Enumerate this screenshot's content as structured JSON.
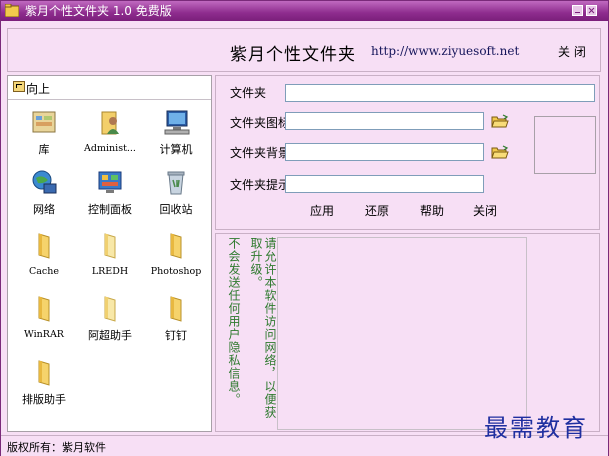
{
  "window": {
    "title": "紫月个性文件夹 1.0 免费版",
    "accent": "#8e2c8e",
    "background": "#f7dff5"
  },
  "header": {
    "app_title": "紫月个性文件夹",
    "url": "http://www.ziyuesoft.net",
    "close_label": "关 闭"
  },
  "left": {
    "up_label": "向上",
    "items": [
      {
        "label": "库",
        "icon": "library-icon"
      },
      {
        "label": "Administ...",
        "icon": "user-folder-icon"
      },
      {
        "label": "计算机",
        "icon": "computer-icon"
      },
      {
        "label": "网络",
        "icon": "network-icon"
      },
      {
        "label": "控制面板",
        "icon": "control-panel-icon"
      },
      {
        "label": "回收站",
        "icon": "recycle-bin-icon"
      },
      {
        "label": "Cache",
        "icon": "folder-icon"
      },
      {
        "label": "LREDH",
        "icon": "folder-icon"
      },
      {
        "label": "Photoshop",
        "icon": "folder-icon"
      },
      {
        "label": "WinRAR",
        "icon": "folder-icon"
      },
      {
        "label": "阿超助手",
        "icon": "folder-icon"
      },
      {
        "label": "钉钉",
        "icon": "folder-icon"
      },
      {
        "label": "排版助手",
        "icon": "folder-icon"
      }
    ]
  },
  "form": {
    "folder_label": "文件夹",
    "folder_value": "",
    "icon_label": "文件夹图标",
    "icon_value": "",
    "bg_label": "文件夹背景",
    "bg_value": "",
    "tip_label": "文件夹提示",
    "tip_value": "",
    "apply_label": "应用",
    "restore_label": "还原",
    "help_label": "帮助",
    "close_label": "关闭"
  },
  "notice": {
    "line1": "请允许本软件访问网络，以便获取升级。",
    "line2": "不会发送任何用户隐私信息。"
  },
  "status": {
    "copyright": "版权所有：紫月软件"
  },
  "watermark": "最需教育"
}
